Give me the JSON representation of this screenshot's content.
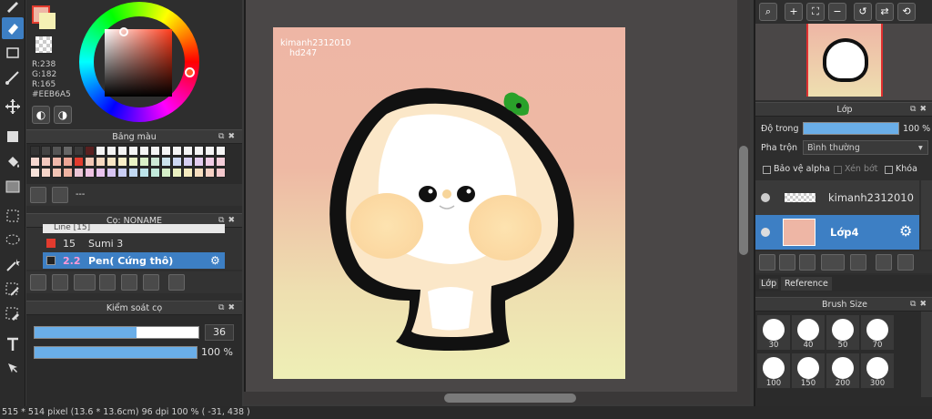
{
  "color": {
    "r_label": "R:238",
    "g_label": "G:182",
    "b_label": "R:165",
    "hex_label": "#EEB6A5",
    "primary": "#eeb6a5",
    "accent": "#3d7fc4"
  },
  "palette_panel": {
    "title": "Bảng màu",
    "none_label": "---"
  },
  "brush_panel": {
    "title": "Cọ: NONAME",
    "items": [
      {
        "label": "Line [15]"
      },
      {
        "num": "15",
        "label": "Sumi 3"
      },
      {
        "num": "2.2",
        "label": "Pen( Cứng thô)"
      }
    ]
  },
  "brush_control": {
    "title": "Kiểm soát cọ",
    "size_value": "36",
    "opacity_value": "100 %",
    "size_fraction": 0.62,
    "opacity_fraction": 1.0
  },
  "canvas": {
    "watermark_line1": "kimanh2312010",
    "watermark_line2": "hd247"
  },
  "layer_panel": {
    "title": "Lớp",
    "opacity_label": "Độ trong",
    "opacity_value": "100 %",
    "blend_label": "Pha trộn",
    "blend_value": "Bình thường",
    "protect_alpha": "Bảo vệ alpha",
    "clipping": "Xén bớt",
    "lock": "Khóa",
    "layers": [
      {
        "name": "kimanh2312010"
      },
      {
        "name": "Lớp4"
      }
    ],
    "tab_layer": "Lớp",
    "tab_reference": "Reference"
  },
  "brush_size": {
    "title": "Brush Size",
    "sizes": [
      "30",
      "40",
      "50",
      "70",
      "100",
      "150",
      "200",
      "300"
    ]
  },
  "status": {
    "text": "515 * 514 pixel   (13.6 * 13.6cm)   96 dpi   100 %   ( -31, 438 )"
  }
}
